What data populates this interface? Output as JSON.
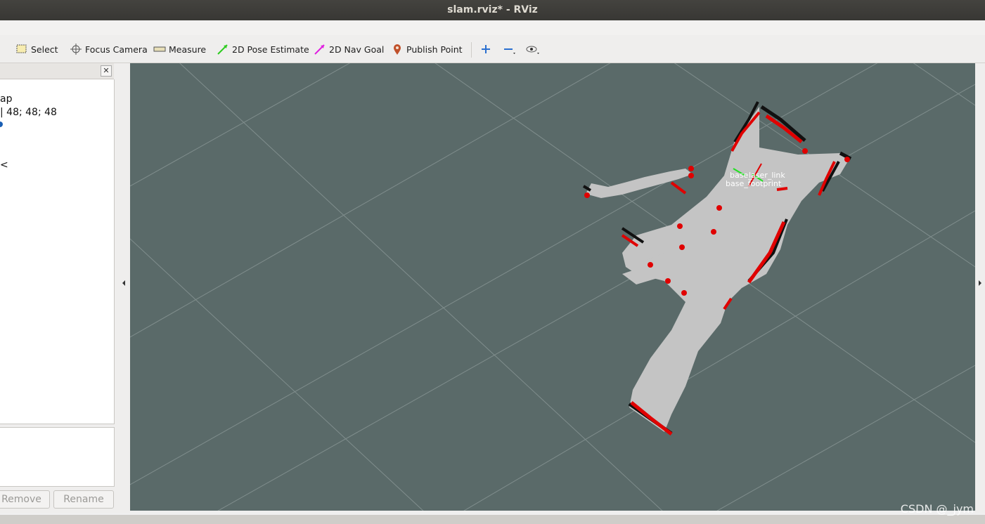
{
  "window": {
    "title": "slam.rviz* - RViz"
  },
  "toolbar": {
    "tools": [
      {
        "label": "Select",
        "icon": "select-icon"
      },
      {
        "label": "Focus Camera",
        "icon": "focus-camera-icon"
      },
      {
        "label": "Measure",
        "icon": "ruler-icon"
      },
      {
        "label": "2D Pose Estimate",
        "icon": "green-arrow-icon"
      },
      {
        "label": "2D Nav Goal",
        "icon": "magenta-arrow-icon"
      },
      {
        "label": "Publish Point",
        "icon": "map-pin-icon"
      }
    ],
    "extra_icons": [
      "plus-icon",
      "minus-icon",
      "eye-icon"
    ]
  },
  "left_panel": {
    "lines": [
      "ap",
      "| 48; 48; 48",
      "",
      "",
      "<"
    ],
    "buttons": {
      "remove": "Remove",
      "rename": "Rename"
    }
  },
  "view": {
    "frames": {
      "base_link_1": "base_",
      "laser_link": "laser_link",
      "base_footprint": "base_footprint"
    },
    "colors": {
      "background": "#5a6a69",
      "free": "#c4c4c4",
      "occupied": "#111111",
      "laser": "#e00000",
      "grid": "#8a9796"
    }
  },
  "watermark": "CSDN @_jym"
}
